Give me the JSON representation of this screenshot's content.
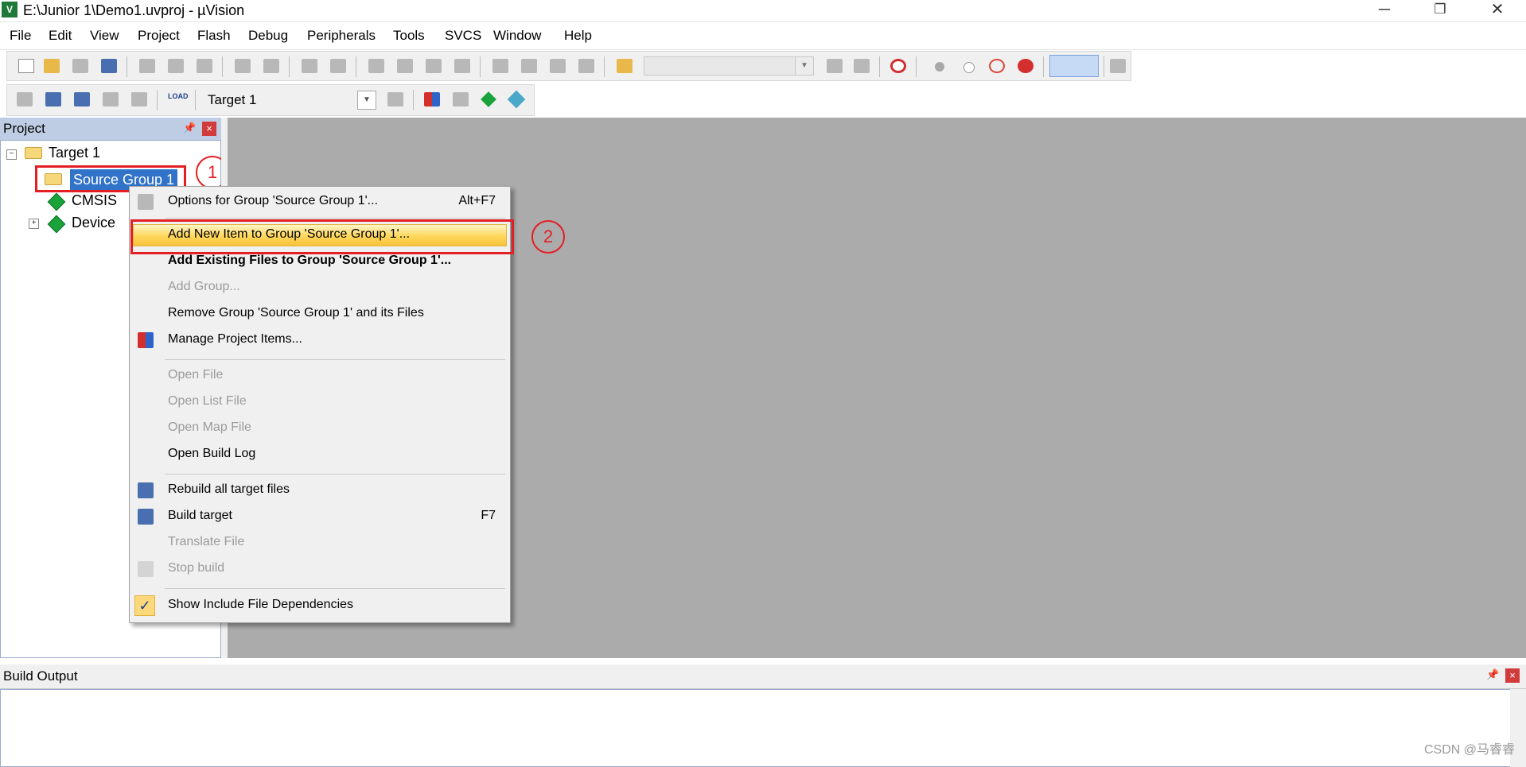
{
  "window": {
    "title": "E:\\Junior 1\\Demo1.uvproj - µVision",
    "app_icon": "uv-icon",
    "minimize": "─",
    "restore": "❐",
    "close": "✕"
  },
  "menubar": {
    "items": [
      "File",
      "Edit",
      "View",
      "Project",
      "Flash",
      "Debug",
      "Peripherals",
      "Tools",
      "SVCS",
      "Window",
      "Help"
    ]
  },
  "toolbar2": {
    "load_label": "LOAD",
    "target_select": "Target 1"
  },
  "project_panel": {
    "title": "Project",
    "pin": "📌",
    "close": "×",
    "tree": {
      "root": "Target 1",
      "group": "Source Group 1",
      "cmsis": "CMSIS",
      "device": "Device"
    }
  },
  "annotations": {
    "step1": "1",
    "step2": "2"
  },
  "context_menu": {
    "options": {
      "label": "Options for Group 'Source Group 1'...",
      "shortcut": "Alt+F7"
    },
    "add_new": {
      "label": "Add New  Item to Group 'Source Group 1'..."
    },
    "add_existing": {
      "label": "Add Existing Files to Group 'Source Group 1'..."
    },
    "add_group": {
      "label": "Add Group..."
    },
    "remove_group": {
      "label": "Remove Group 'Source Group 1' and its Files"
    },
    "manage": {
      "label": "Manage Project Items..."
    },
    "open_file": {
      "label": "Open File"
    },
    "open_list": {
      "label": "Open List File"
    },
    "open_map": {
      "label": "Open Map File"
    },
    "open_build_log": {
      "label": "Open Build Log"
    },
    "rebuild": {
      "label": "Rebuild all target files"
    },
    "build": {
      "label": "Build target",
      "shortcut": "F7"
    },
    "translate": {
      "label": "Translate File"
    },
    "stop": {
      "label": "Stop build"
    },
    "show_deps": {
      "label": "Show Include File Dependencies",
      "checked_mark": "✓"
    }
  },
  "build_output": {
    "title": "Build Output",
    "pin": "📌",
    "close": "×",
    "watermark": "CSDN @马睿睿"
  },
  "colors": {
    "selection": "#3073c9",
    "annotation_red": "#e31e24",
    "menu_highlight": "#ffd75a",
    "editor_bg": "#ababab"
  }
}
